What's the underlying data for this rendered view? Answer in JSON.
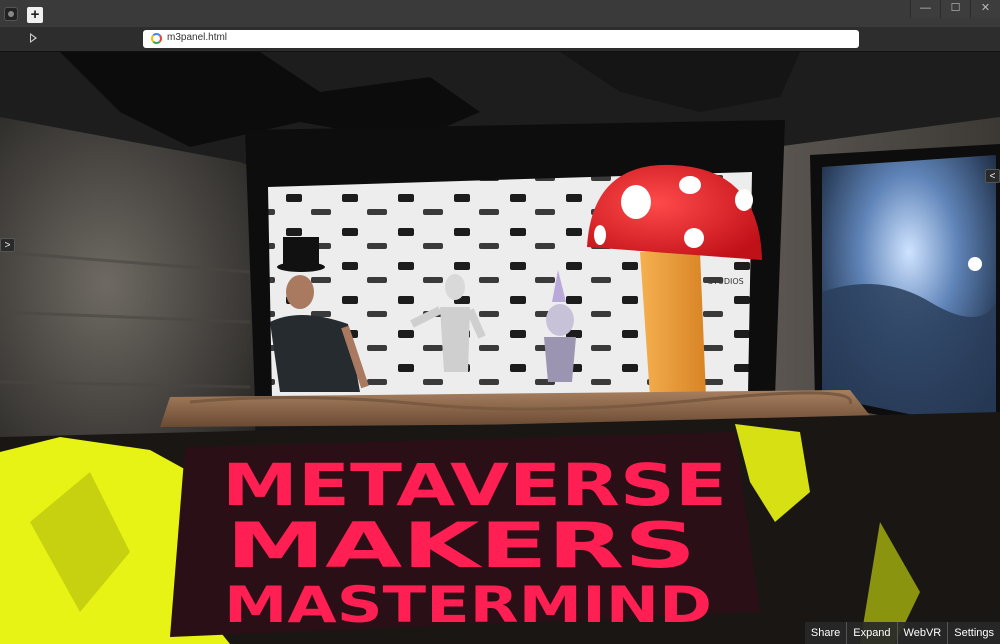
{
  "browser": {
    "url": "m3panel.html",
    "new_tab_label": "+",
    "window_controls": {
      "minimize": "—",
      "maximize": "☐",
      "close": "✕"
    }
  },
  "panels": {
    "left_toggle": ">",
    "right_toggle": "<"
  },
  "banner": {
    "line1": "METAVERSE",
    "line2": "MAKERS",
    "line3": "MASTERMIND"
  },
  "backdrop_logo": "STUDIOS",
  "bottom_bar": {
    "share": "Share",
    "expand": "Expand",
    "webvr": "WebVR",
    "settings": "Settings"
  },
  "colors": {
    "banner": "#ff1f52",
    "foliage": "#e7f215",
    "mushroom_cap": "#e11a22"
  }
}
